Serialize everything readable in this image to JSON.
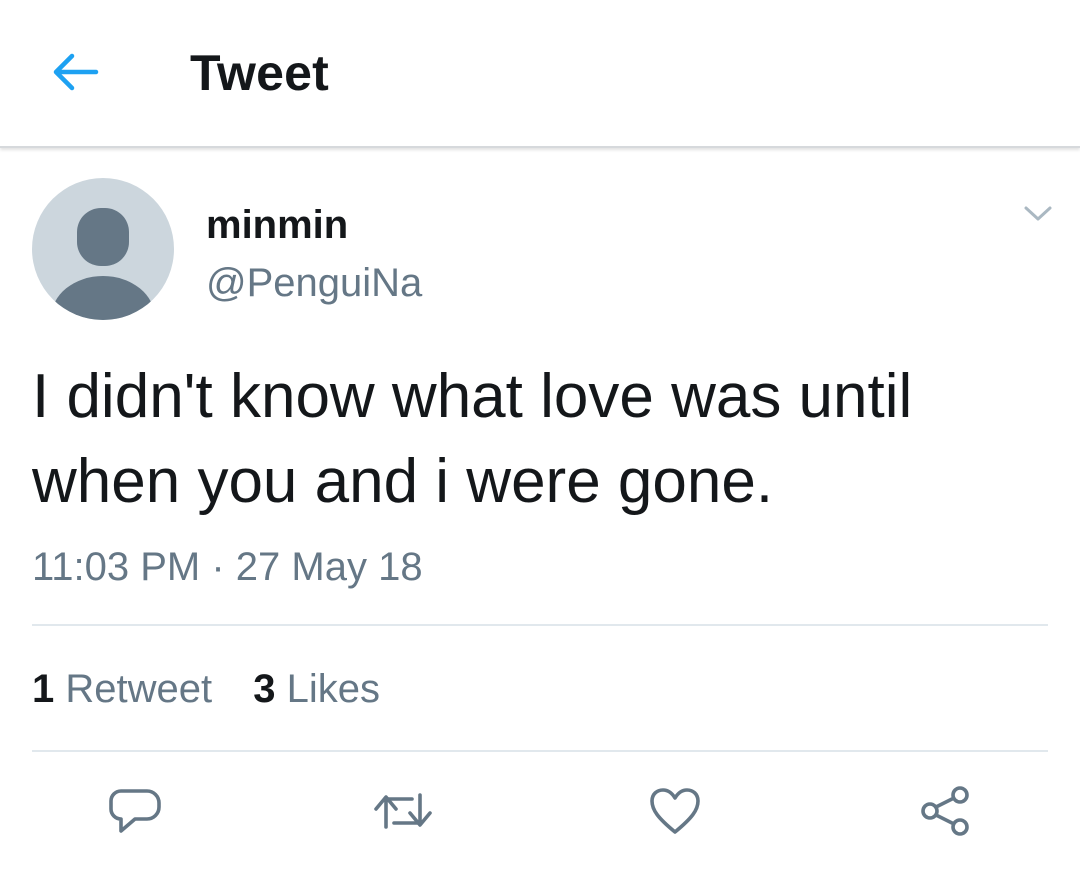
{
  "header": {
    "title": "Tweet",
    "back_icon": "arrow-left-icon"
  },
  "author": {
    "display_name": "minmin",
    "handle": "@PenguiNa",
    "avatar": "default-avatar-icon"
  },
  "tweet": {
    "text": "I didn't know what love was until when you and i were gone.",
    "timestamp": "11:03 PM · 27 May 18"
  },
  "stats": {
    "retweet_count": "1",
    "retweet_label": "Retweet",
    "like_count": "3",
    "like_label": "Likes"
  },
  "actions": [
    {
      "name": "reply",
      "icon": "reply-icon"
    },
    {
      "name": "retweet",
      "icon": "retweet-icon"
    },
    {
      "name": "like",
      "icon": "heart-icon"
    },
    {
      "name": "share",
      "icon": "share-icon"
    }
  ],
  "colors": {
    "accent": "#1da1f2",
    "text_primary": "#14171a",
    "text_secondary": "#657786",
    "divider": "#e1e8ed",
    "avatar_bg": "#ccd6dd",
    "avatar_figure": "#657786"
  }
}
